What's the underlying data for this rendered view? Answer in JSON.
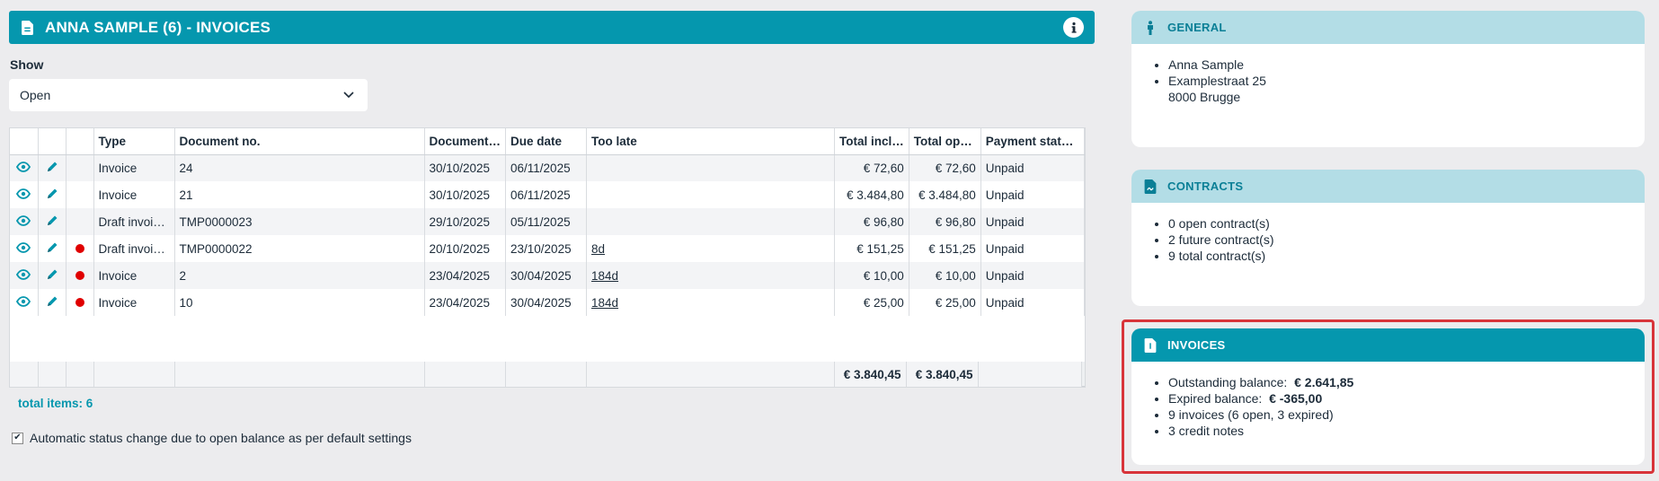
{
  "header": {
    "title": "ANNA SAMPLE (6) - INVOICES",
    "info_icon": "info-icon",
    "doc_icon": "document-icon"
  },
  "filter": {
    "label": "Show",
    "selected": "Open"
  },
  "table": {
    "columns": [
      "",
      "",
      "Type",
      "Document no.",
      "Document…",
      "Due date",
      "Too late",
      "Total incl…",
      "Total op…",
      "Payment stat…"
    ],
    "rows": [
      {
        "dot": false,
        "type": "Invoice",
        "doc_no": "24",
        "doc_date": "30/10/2025",
        "due_date": "06/11/2025",
        "too_late": "",
        "total_incl": "€ 72,60",
        "total_open": "€ 72,60",
        "status": "Unpaid"
      },
      {
        "dot": false,
        "type": "Invoice",
        "doc_no": "21",
        "doc_date": "30/10/2025",
        "due_date": "06/11/2025",
        "too_late": "",
        "total_incl": "€ 3.484,80",
        "total_open": "€ 3.484,80",
        "status": "Unpaid"
      },
      {
        "dot": false,
        "type": "Draft invoi…",
        "doc_no": "TMP0000023",
        "doc_date": "29/10/2025",
        "due_date": "05/11/2025",
        "too_late": "",
        "total_incl": "€ 96,80",
        "total_open": "€ 96,80",
        "status": "Unpaid"
      },
      {
        "dot": true,
        "type": "Draft invoi…",
        "doc_no": "TMP0000022",
        "doc_date": "20/10/2025",
        "due_date": "23/10/2025",
        "too_late": "8d",
        "total_incl": "€ 151,25",
        "total_open": "€ 151,25",
        "status": "Unpaid"
      },
      {
        "dot": true,
        "type": "Invoice",
        "doc_no": "2",
        "doc_date": "23/04/2025",
        "due_date": "30/04/2025",
        "too_late": "184d",
        "total_incl": "€ 10,00",
        "total_open": "€ 10,00",
        "status": "Unpaid"
      },
      {
        "dot": true,
        "type": "Invoice",
        "doc_no": "10",
        "doc_date": "23/04/2025",
        "due_date": "30/04/2025",
        "too_late": "184d",
        "total_incl": "€ 25,00",
        "total_open": "€ 25,00",
        "status": "Unpaid"
      }
    ],
    "totals": {
      "total_incl": "€ 3.840,45",
      "total_open": "€ 3.840,45"
    },
    "total_items": "total items: 6"
  },
  "auto_status": {
    "checked": true,
    "label": "Automatic status change due to open balance as per default settings"
  },
  "panels": {
    "general": {
      "title": "GENERAL",
      "icon": "person-icon",
      "items": [
        "Anna Sample",
        "Examplestraat 25",
        "8000 Brugge"
      ]
    },
    "contracts": {
      "title": "CONTRACTS",
      "icon": "contract-icon",
      "items": [
        "0 open contract(s)",
        "2 future contract(s)",
        "9 total contract(s)"
      ]
    },
    "invoices": {
      "title": "INVOICES",
      "icon": "invoice-icon",
      "outstanding_label": "Outstanding balance:",
      "outstanding_value": "€ 2.641,85",
      "expired_label": "Expired balance:",
      "expired_value": "€ -365,00",
      "count_text": "9 invoices (6 open, 3 expired)",
      "credit_text": "3 credit notes"
    }
  },
  "colors": {
    "accent": "#0597ae",
    "panel_light": "#b3dde6",
    "highlight": "#d8343a",
    "overdue_dot": "#e00000"
  }
}
